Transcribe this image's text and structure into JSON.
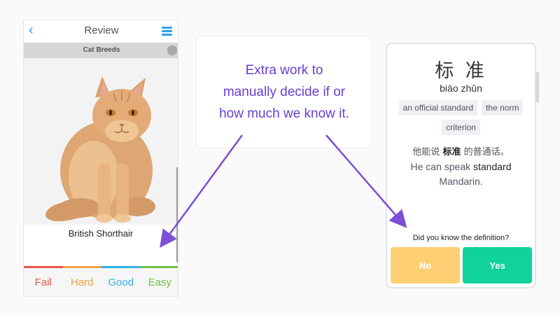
{
  "left_app": {
    "nav": {
      "title": "Review",
      "back_icon": "chevron-left-icon",
      "menu_icon": "hamburger-menu-icon",
      "accent": "#27a3e6"
    },
    "deck": {
      "name": "Cat Breeds"
    },
    "card": {
      "image": "cat-photo",
      "answer": "British Shorthair"
    },
    "grades": [
      {
        "label": "Fail",
        "color": "#e8574a"
      },
      {
        "label": "Hard",
        "color": "#f0a04b"
      },
      {
        "label": "Good",
        "color": "#2fb2e8"
      },
      {
        "label": "Easy",
        "color": "#6cc04a"
      }
    ]
  },
  "callout": {
    "lines": [
      "Extra work to",
      "manually decide if or",
      "how much we know it."
    ],
    "color": "#6a3fd1"
  },
  "right_app": {
    "hanzi": "标 准",
    "pinyin": "biāo zhǔn",
    "meanings": [
      "an official standard",
      "the norm",
      "criterion"
    ],
    "example_zh": {
      "before": "他能说 ",
      "highlight": "标准",
      "after": " 的普通话。"
    },
    "example_en": {
      "before": "He can speak ",
      "highlight": "standard",
      "after": " Mandarin."
    },
    "prompt": "Did you know the definition?",
    "buttons": {
      "no": "No",
      "yes": "Yes",
      "no_color": "#ffd073",
      "yes_color": "#11d29b"
    }
  }
}
